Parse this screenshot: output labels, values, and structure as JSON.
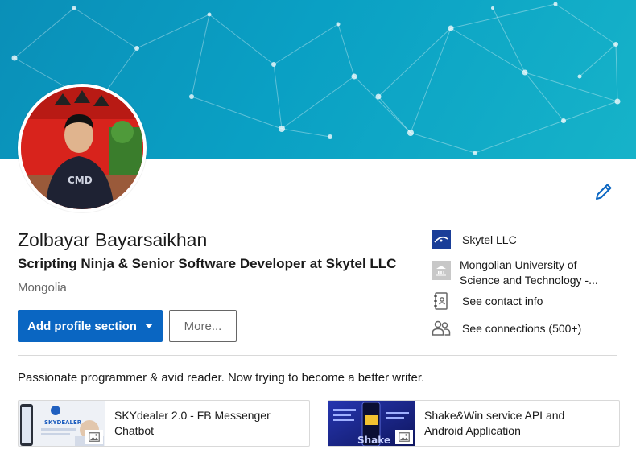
{
  "profile": {
    "name": "Zolbayar Bayarsaikhan",
    "headline": "Scripting Ninja & Senior Software Developer at Skytel LLC",
    "location": "Mongolia",
    "summary": "Passionate programmer & avid reader. Now trying to become a better writer."
  },
  "actions": {
    "add_section_label": "Add profile section",
    "more_label": "More..."
  },
  "sidebar": {
    "company": "Skytel LLC",
    "school_line1": "Mongolian University of",
    "school_line2": "Science and Technology -...",
    "contact": "See contact info",
    "connections": "See connections (500+)"
  },
  "media": [
    {
      "title_line1": "SKYdealer 2.0 - FB Messenger",
      "title_line2": "Chatbot",
      "thumb_caption": "SKYDEALER"
    },
    {
      "title_line1": "Shake&Win service API and",
      "title_line2": "Android Application",
      "thumb_caption": "Shake"
    }
  ],
  "icons": {
    "edit": "pencil-icon",
    "contact": "address-book-icon",
    "connections": "people-icon",
    "dropdown": "caret-down-icon",
    "media_type": "image-icon"
  },
  "colors": {
    "primary": "#0a66c2",
    "banner_start": "#0a8fb8",
    "banner_end": "#16b3c9",
    "company_logo": "#1a3e98"
  }
}
